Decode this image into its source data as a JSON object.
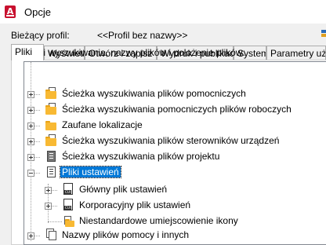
{
  "window": {
    "title": "Opcje",
    "app_icon_letter": "A"
  },
  "profile": {
    "label": "Bieżący profil:",
    "value": "<<Profil bez nazwy>>"
  },
  "tabs": [
    {
      "label": "Pliki",
      "active": true
    },
    {
      "label": "Wyświetl"
    },
    {
      "label": "Otwórz i zapisz"
    },
    {
      "label": "Wydruk i publikacja"
    },
    {
      "label": "System"
    },
    {
      "label": "Parametry użytkownika"
    }
  ],
  "files": {
    "section_label": "Ścieżki wyszukiwania, nazwy plików i położenie plików:",
    "tree": [
      {
        "label": "Ścieżka wyszukiwania plików pomocniczych",
        "icon": "folder-search-icon",
        "expanded": false
      },
      {
        "label": "Ścieżka wyszukiwania pomocniczych plików roboczych",
        "icon": "folder-search-icon",
        "expanded": false
      },
      {
        "label": "Zaufane lokalizacje",
        "icon": "folder-icon",
        "expanded": false
      },
      {
        "label": "Ścieżka wyszukiwania plików sterowników urządzeń",
        "icon": "folder-search-icon",
        "expanded": false
      },
      {
        "label": "Ścieżka wyszukiwania plików projektu",
        "icon": "project-file-icon",
        "expanded": false
      },
      {
        "label": "Pliki ustawień",
        "icon": "settings-file-icon",
        "expanded": true,
        "selected": true,
        "children": [
          {
            "label": "Główny plik ustawień",
            "icon": "cui-file-icon",
            "expanded": false
          },
          {
            "label": "Korporacyjny plik ustawień",
            "icon": "cui-file-icon",
            "expanded": false
          },
          {
            "label": "Niestandardowe umiejscowienie ikony",
            "icon": "folder-icon",
            "expanded": null
          }
        ]
      },
      {
        "label": "Nazwy plików pomocy i innych",
        "icon": "help-files-icon",
        "expanded": false
      }
    ]
  },
  "colors": {
    "selection": "#0078d7",
    "folder": "#f8b933",
    "app_icon": "#c8102e"
  }
}
